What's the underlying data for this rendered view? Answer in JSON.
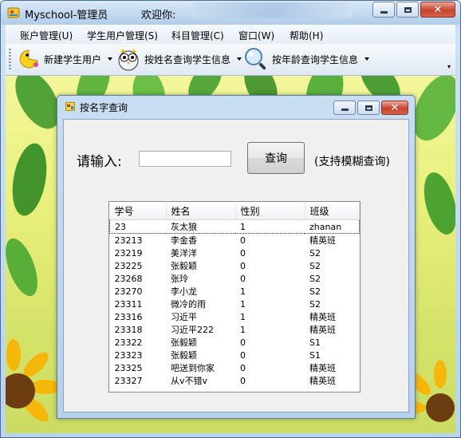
{
  "app": {
    "title": "Myschool-管理员",
    "welcome_label": "欢迎你:"
  },
  "menu": {
    "items": [
      {
        "label": "账户管理(U)"
      },
      {
        "label": "学生用户管理(S)"
      },
      {
        "label": "科目管理(C)"
      },
      {
        "label": "窗口(W)"
      },
      {
        "label": "帮助(H)"
      }
    ]
  },
  "toolbar": {
    "buttons": [
      {
        "label": "新建学生用户",
        "icon": "pacman-smiley-icon"
      },
      {
        "label": "按姓名查询学生信息",
        "icon": "owl-icon"
      },
      {
        "label": "按年龄查询学生信息",
        "icon": "magnifier-icon"
      }
    ]
  },
  "dialog": {
    "title": "按名字查询",
    "prompt_label": "请输入:",
    "name_input_value": "",
    "query_button_label": "查询",
    "hint": "(支持模糊查询)"
  },
  "table": {
    "columns": [
      "学号",
      "姓名",
      "性别",
      "班级"
    ],
    "rows": [
      [
        "23",
        "灰太狼",
        "1",
        "zhanan"
      ],
      [
        "23213",
        "李金香",
        "0",
        "精英班"
      ],
      [
        "23219",
        "美洋洋",
        "0",
        "S2"
      ],
      [
        "23225",
        "张毅颖",
        "0",
        "S2"
      ],
      [
        "23268",
        "张玲",
        "0",
        "S2"
      ],
      [
        "23270",
        "李小龙",
        "1",
        "S2"
      ],
      [
        "23311",
        "微冷的雨",
        "1",
        "S2"
      ],
      [
        "23316",
        "习近平",
        "1",
        "精英班"
      ],
      [
        "23318",
        "习近平222",
        "1",
        "精英班"
      ],
      [
        "23322",
        "张毅颖",
        "0",
        "S1"
      ],
      [
        "23323",
        "张毅颖",
        "0",
        "S1"
      ],
      [
        "23325",
        "吧送到你家",
        "0",
        "精英班"
      ],
      [
        "23327",
        "从v不错v",
        "0",
        "精英班"
      ]
    ],
    "selected_row": 0
  },
  "colors": {
    "title_gradient_top": "#dbe9f7",
    "close_red": "#c7432c",
    "desktop_yellow": "#e9f07c",
    "leaf_green": "#3a8f2a"
  }
}
